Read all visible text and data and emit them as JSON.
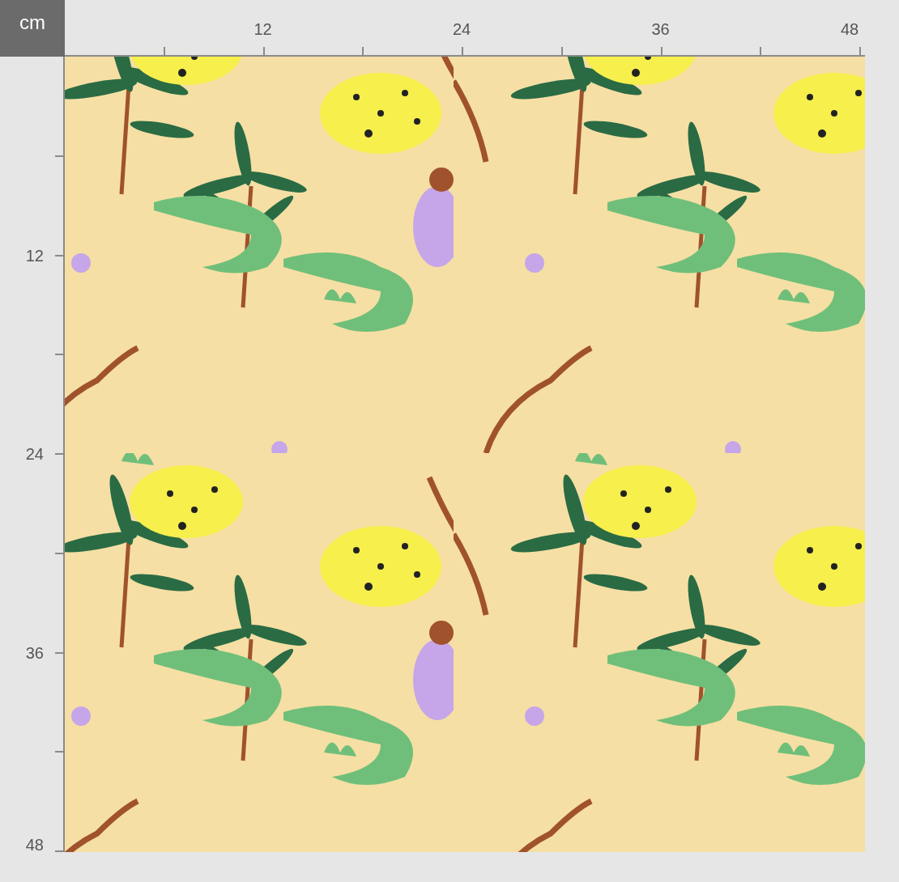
{
  "unit_label": "cm",
  "top_ruler": {
    "labels": [
      "12",
      "24",
      "36",
      "48"
    ]
  },
  "left_ruler": {
    "labels": [
      "12",
      "24",
      "36",
      "48"
    ]
  }
}
